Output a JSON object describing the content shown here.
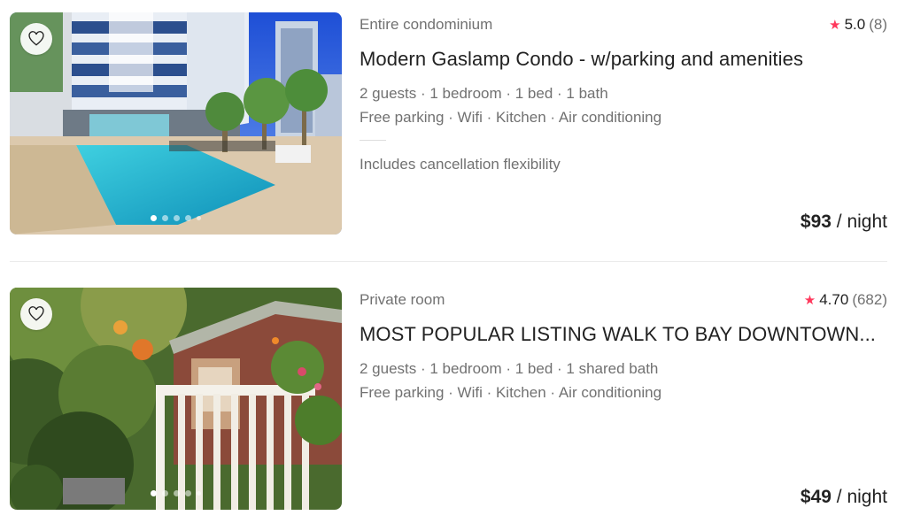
{
  "listings": [
    {
      "property_type": "Entire condominium",
      "rating": "5.0",
      "review_count": "(8)",
      "title": "Modern Gaslamp Condo - w/parking and amenities",
      "rooms": "2 guests · 1 bedroom · 1 bed · 1 bath",
      "amenities": "Free parking · Wifi · Kitchen · Air conditioning",
      "flexibility": "Includes cancellation flexibility",
      "price": "$93",
      "price_unit": " / night",
      "photo_index": 1,
      "photo_count": 5
    },
    {
      "property_type": "Private room",
      "rating": "4.70",
      "review_count": "(682)",
      "title": "MOST POPULAR LISTING WALK TO BAY DOWNTOWN...",
      "rooms": "2 guests · 1 bedroom · 1 bed · 1 shared bath",
      "amenities": "Free parking · Wifi · Kitchen · Air conditioning",
      "price": "$49",
      "price_unit": " / night",
      "photo_index": 1,
      "photo_count": 5
    }
  ],
  "icons": {
    "save": "heart-icon",
    "rating": "star-icon"
  },
  "colors": {
    "accent": "#ff385c",
    "text": "#222222",
    "secondary": "#717171"
  }
}
